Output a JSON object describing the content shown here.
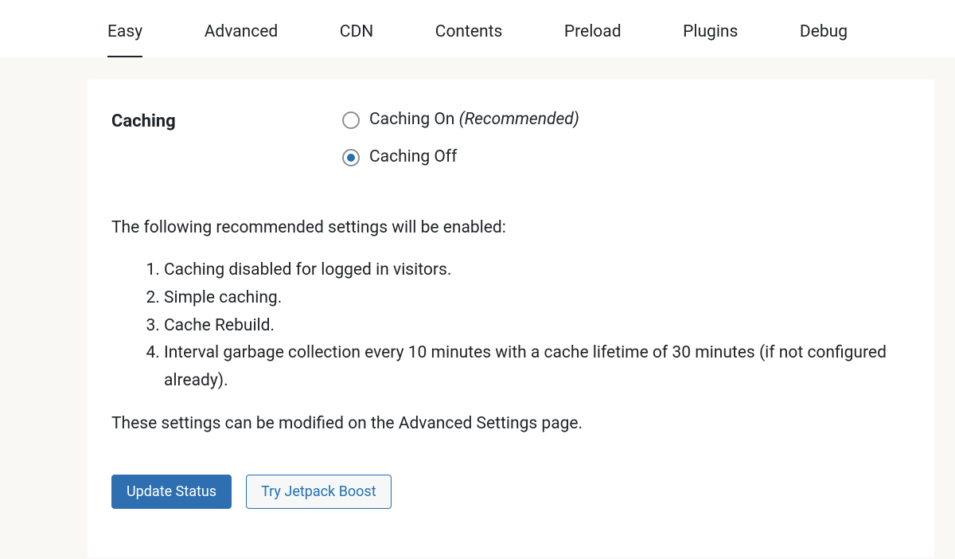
{
  "tabs": {
    "items": [
      {
        "label": "Easy",
        "active": true
      },
      {
        "label": "Advanced",
        "active": false
      },
      {
        "label": "CDN",
        "active": false
      },
      {
        "label": "Contents",
        "active": false
      },
      {
        "label": "Preload",
        "active": false
      },
      {
        "label": "Plugins",
        "active": false
      },
      {
        "label": "Debug",
        "active": false
      }
    ]
  },
  "section": {
    "title": "Caching",
    "options": {
      "on_label": "Caching On ",
      "on_hint": "(Recommended)",
      "off_label": "Caching Off",
      "selected": "off"
    }
  },
  "description": {
    "intro": "The following recommended settings will be enabled:",
    "items": [
      "Caching disabled for logged in visitors.",
      "Simple caching.",
      "Cache Rebuild.",
      "Interval garbage collection every 10 minutes with a cache lifetime of 30 minutes (if not configured already)."
    ],
    "outro": "These settings can be modified on the Advanced Settings page."
  },
  "buttons": {
    "primary": "Update Status",
    "secondary": "Try Jetpack Boost"
  },
  "colors": {
    "accent": "#2271b1",
    "primary_btn": "#2d6fb1",
    "text": "#1d2327",
    "bg": "#f9f8f5"
  }
}
